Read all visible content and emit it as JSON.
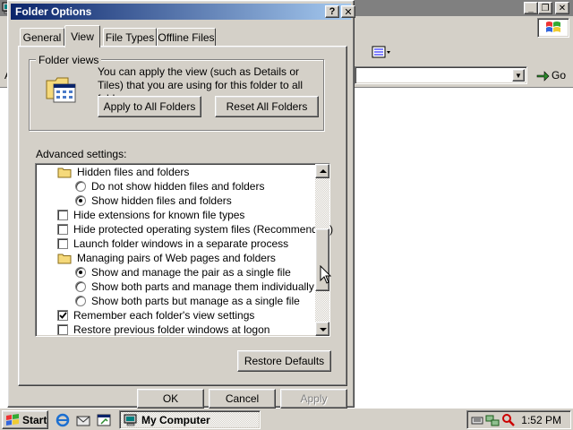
{
  "background_window": {
    "title_buttons": {
      "minimize": "_",
      "restore": "❐",
      "close": "✕"
    },
    "address_label": "A",
    "address_value": "",
    "go_label": "Go"
  },
  "dialog": {
    "title": "Folder Options",
    "help_label": "?",
    "close_label": "✕",
    "tabs": [
      "General",
      "View",
      "File Types",
      "Offline Files"
    ],
    "active_tab": "View",
    "folder_views": {
      "legend": "Folder views",
      "description": "You can apply the view (such as Details or Tiles) that you are using for this folder to all folders.",
      "apply_all_label": "Apply to All Folders",
      "reset_all_label": "Reset All Folders"
    },
    "advanced_label": "Advanced settings:",
    "settings": [
      {
        "type": "folder",
        "label": "Hidden files and folders",
        "indent": 0
      },
      {
        "type": "radio",
        "label": "Do not show hidden files and folders",
        "checked": false,
        "indent": 1
      },
      {
        "type": "radio",
        "label": "Show hidden files and folders",
        "checked": true,
        "indent": 1
      },
      {
        "type": "checkbox",
        "label": "Hide extensions for known file types",
        "checked": false,
        "indent": 0
      },
      {
        "type": "checkbox",
        "label": "Hide protected operating system files (Recommended)",
        "checked": false,
        "indent": 0
      },
      {
        "type": "checkbox",
        "label": "Launch folder windows in a separate process",
        "checked": false,
        "indent": 0
      },
      {
        "type": "folder",
        "label": "Managing pairs of Web pages and folders",
        "indent": 0
      },
      {
        "type": "radio",
        "label": "Show and manage the pair as a single file",
        "checked": true,
        "indent": 1
      },
      {
        "type": "radio",
        "label": "Show both parts and manage them individually",
        "checked": false,
        "indent": 1
      },
      {
        "type": "radio",
        "label": "Show both parts but manage as a single file",
        "checked": false,
        "indent": 1
      },
      {
        "type": "checkbox",
        "label": "Remember each folder's view settings",
        "checked": true,
        "indent": 0
      },
      {
        "type": "checkbox",
        "label": "Restore previous folder windows at logon",
        "checked": false,
        "indent": 0
      }
    ],
    "restore_defaults_label": "Restore Defaults",
    "ok_label": "OK",
    "cancel_label": "Cancel",
    "apply_label": "Apply"
  },
  "taskbar": {
    "start_label": "Start",
    "task_label": "My Computer",
    "clock": "1:52 PM"
  },
  "colors": {
    "title_active_start": "#0a246a",
    "title_active_end": "#a6caf0",
    "face": "#d4d0c8"
  }
}
